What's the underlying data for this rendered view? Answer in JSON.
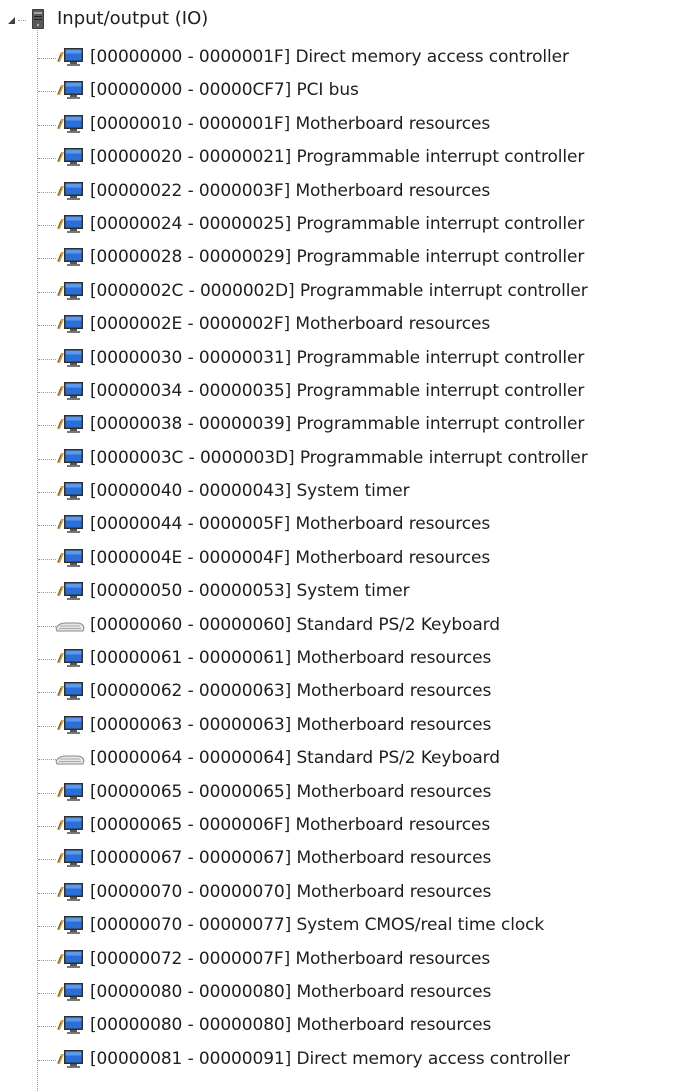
{
  "tree": {
    "root": {
      "label": "Input/output (IO)",
      "icon": "computer-tower-icon",
      "expanded": true
    },
    "items": [
      {
        "range": "[00000000 - 0000001F]",
        "description": "Direct memory access controller",
        "icon": "system-device-icon"
      },
      {
        "range": "[00000000 - 00000CF7]",
        "description": "PCI bus",
        "icon": "system-device-icon"
      },
      {
        "range": "[00000010 - 0000001F]",
        "description": "Motherboard resources",
        "icon": "system-device-icon"
      },
      {
        "range": "[00000020 - 00000021]",
        "description": "Programmable interrupt controller",
        "icon": "system-device-icon"
      },
      {
        "range": "[00000022 - 0000003F]",
        "description": "Motherboard resources",
        "icon": "system-device-icon"
      },
      {
        "range": "[00000024 - 00000025]",
        "description": "Programmable interrupt controller",
        "icon": "system-device-icon"
      },
      {
        "range": "[00000028 - 00000029]",
        "description": "Programmable interrupt controller",
        "icon": "system-device-icon"
      },
      {
        "range": "[0000002C - 0000002D]",
        "description": "Programmable interrupt controller",
        "icon": "system-device-icon"
      },
      {
        "range": "[0000002E - 0000002F]",
        "description": "Motherboard resources",
        "icon": "system-device-icon"
      },
      {
        "range": "[00000030 - 00000031]",
        "description": "Programmable interrupt controller",
        "icon": "system-device-icon"
      },
      {
        "range": "[00000034 - 00000035]",
        "description": "Programmable interrupt controller",
        "icon": "system-device-icon"
      },
      {
        "range": "[00000038 - 00000039]",
        "description": "Programmable interrupt controller",
        "icon": "system-device-icon"
      },
      {
        "range": "[0000003C - 0000003D]",
        "description": "Programmable interrupt controller",
        "icon": "system-device-icon"
      },
      {
        "range": "[00000040 - 00000043]",
        "description": "System timer",
        "icon": "system-device-icon"
      },
      {
        "range": "[00000044 - 0000005F]",
        "description": "Motherboard resources",
        "icon": "system-device-icon"
      },
      {
        "range": "[0000004E - 0000004F]",
        "description": "Motherboard resources",
        "icon": "system-device-icon"
      },
      {
        "range": "[00000050 - 00000053]",
        "description": "System timer",
        "icon": "system-device-icon"
      },
      {
        "range": "[00000060 - 00000060]",
        "description": "Standard PS/2 Keyboard",
        "icon": "keyboard-icon"
      },
      {
        "range": "[00000061 - 00000061]",
        "description": "Motherboard resources",
        "icon": "system-device-icon"
      },
      {
        "range": "[00000062 - 00000063]",
        "description": "Motherboard resources",
        "icon": "system-device-icon"
      },
      {
        "range": "[00000063 - 00000063]",
        "description": "Motherboard resources",
        "icon": "system-device-icon"
      },
      {
        "range": "[00000064 - 00000064]",
        "description": "Standard PS/2 Keyboard",
        "icon": "keyboard-icon"
      },
      {
        "range": "[00000065 - 00000065]",
        "description": "Motherboard resources",
        "icon": "system-device-icon"
      },
      {
        "range": "[00000065 - 0000006F]",
        "description": "Motherboard resources",
        "icon": "system-device-icon"
      },
      {
        "range": "[00000067 - 00000067]",
        "description": "Motherboard resources",
        "icon": "system-device-icon"
      },
      {
        "range": "[00000070 - 00000070]",
        "description": "Motherboard resources",
        "icon": "system-device-icon"
      },
      {
        "range": "[00000070 - 00000077]",
        "description": "System CMOS/real time clock",
        "icon": "system-device-icon"
      },
      {
        "range": "[00000072 - 0000007F]",
        "description": "Motherboard resources",
        "icon": "system-device-icon"
      },
      {
        "range": "[00000080 - 00000080]",
        "description": "Motherboard resources",
        "icon": "system-device-icon"
      },
      {
        "range": "[00000080 - 00000080]",
        "description": "Motherboard resources",
        "icon": "system-device-icon"
      },
      {
        "range": "[00000081 - 00000091]",
        "description": "Direct memory access controller",
        "icon": "system-device-icon"
      }
    ]
  }
}
